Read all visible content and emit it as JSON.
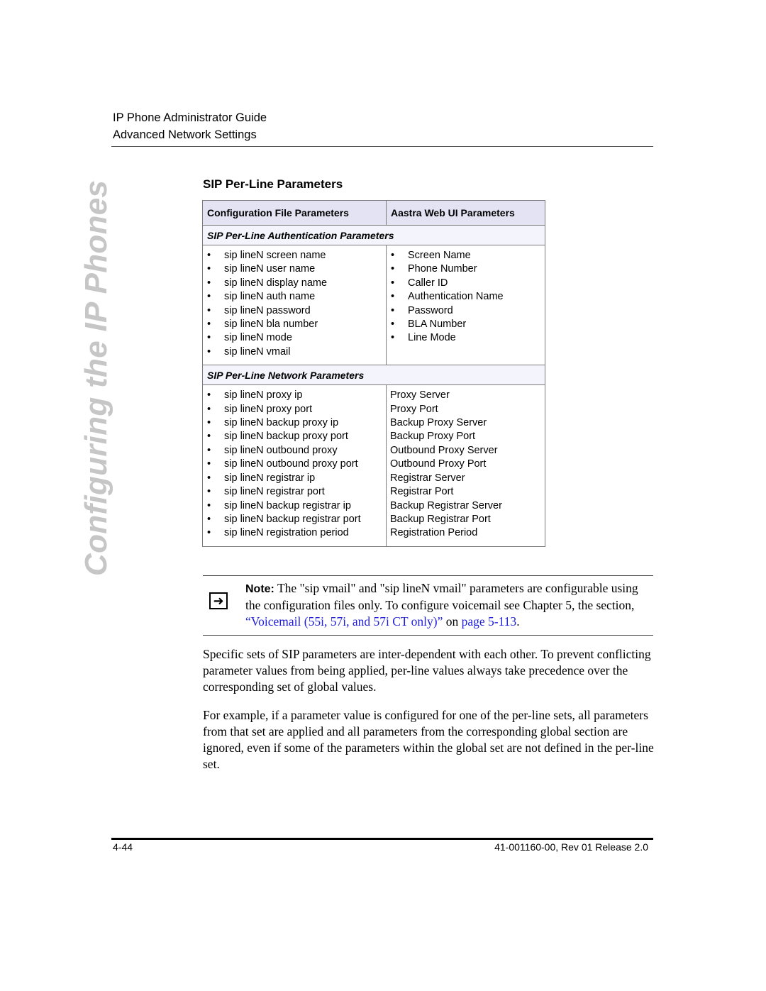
{
  "running_head": {
    "line1": "IP Phone Administrator Guide",
    "line2": "Advanced Network Settings"
  },
  "side_tab": "Configuring the IP Phones",
  "section_title": "SIP Per-Line Parameters",
  "table": {
    "headers": [
      "Configuration File Parameters",
      "Aastra Web UI Parameters"
    ],
    "sections": [
      {
        "title": "SIP Per-Line Authentication Parameters",
        "config_params": [
          "sip lineN screen name",
          "sip lineN user name",
          "sip lineN display name",
          "sip lineN auth name",
          "sip lineN password",
          "sip lineN bla number",
          "sip lineN mode",
          "sip lineN vmail"
        ],
        "web_ui_bulleted": true,
        "web_ui_params": [
          "Screen Name",
          "Phone Number",
          "Caller ID",
          "Authentication Name",
          "Password",
          "BLA Number",
          "Line Mode"
        ]
      },
      {
        "title": "SIP Per-Line Network Parameters",
        "config_params": [
          "sip lineN proxy ip",
          "sip lineN proxy port",
          "sip lineN backup proxy ip",
          "sip lineN backup proxy port",
          "sip lineN outbound proxy",
          "sip lineN outbound proxy port",
          "sip lineN registrar ip",
          "sip lineN registrar port",
          "sip lineN backup registrar ip",
          "sip lineN backup registrar port",
          "sip lineN registration period"
        ],
        "web_ui_bulleted": false,
        "web_ui_params": [
          "Proxy Server",
          "Proxy Port",
          "Backup Proxy Server",
          "Backup Proxy Port",
          "Outbound Proxy Server",
          "Outbound Proxy Port",
          "Registrar Server",
          "Registrar Port",
          "Backup Registrar Server",
          "Backup Registrar Port",
          "Registration Period"
        ]
      }
    ]
  },
  "note": {
    "icon": "arrow-right-icon",
    "label": "Note:",
    "text_before": " The \"sip vmail\" and \"sip lineN vmail\" parameters are configurable using the configuration files only. To configure voicemail see Chapter 5, the section, ",
    "link_section": "“Voicemail (55i, 57i, and 57i CT only)”",
    "text_mid": " on ",
    "link_page": "page 5-113",
    "text_after": "."
  },
  "paragraphs": [
    "Specific sets of SIP parameters are inter-dependent with each other. To prevent conflicting parameter values from being applied, per-line values always take precedence over the corresponding set of global values.",
    "For example, if a parameter value is configured for one of the per-line sets, all parameters from that set are applied and all parameters from the corresponding global section are ignored, even if some of the parameters within the global set are not defined in the per-line set."
  ],
  "footer": {
    "page_number": "4-44",
    "doc_id": "41-001160-00, Rev 01  Release 2.0"
  },
  "colors": {
    "header_row": "#e3e3f4",
    "section_row": "#f4f4fc",
    "link": "#1f1fd8",
    "side_tab": "#c6c6c6"
  }
}
